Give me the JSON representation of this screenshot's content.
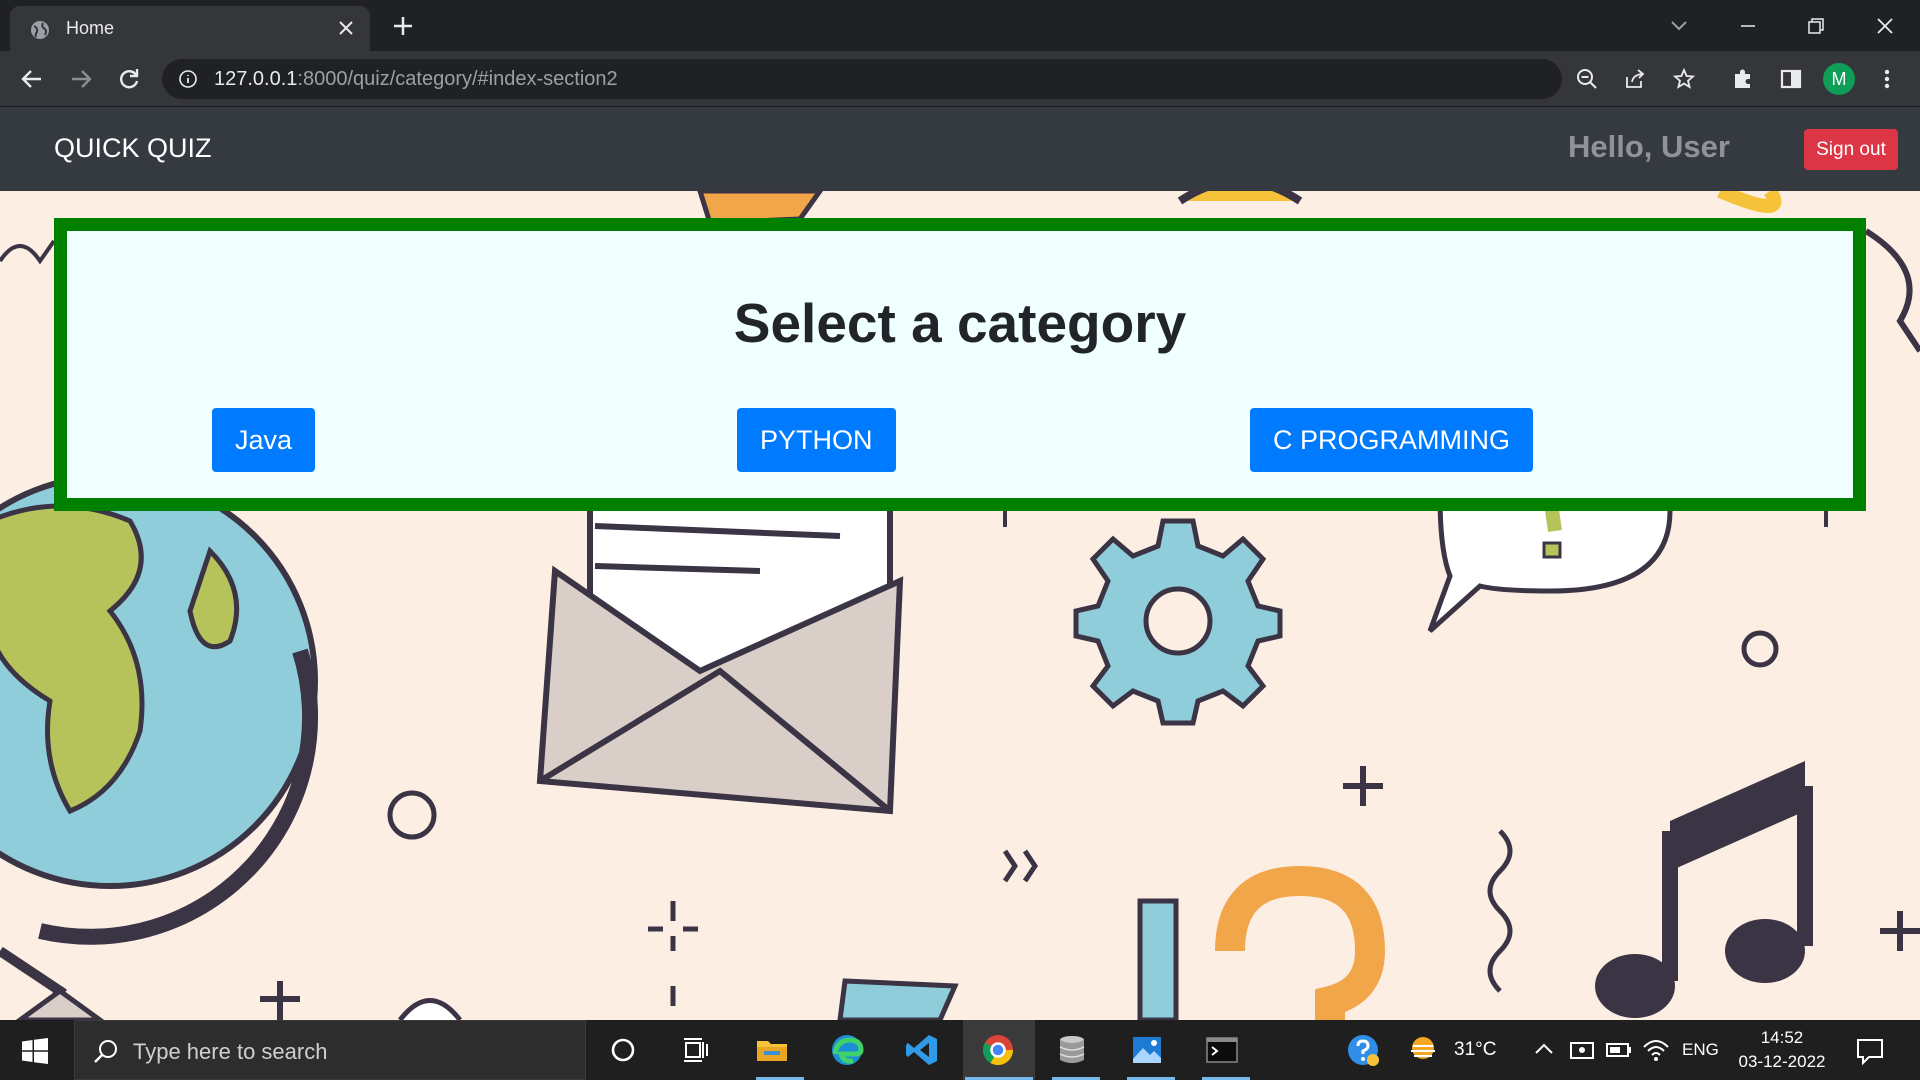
{
  "browser": {
    "tab_title": "Home",
    "url_host": "127.0.0.1",
    "url_rest": ":8000/quiz/category/#index-section2",
    "profile_initial": "M"
  },
  "navbar": {
    "brand": "QUICK QUIZ",
    "greeting": "Hello, User",
    "signout_label": "Sign out"
  },
  "main": {
    "heading": "Select a category",
    "categories": [
      "Java",
      "PYTHON",
      "C PROGRAMMING"
    ]
  },
  "taskbar": {
    "search_placeholder": "Type here to search",
    "temperature": "31°C",
    "language": "ENG",
    "time": "14:52",
    "date": "03-12-2022"
  },
  "colors": {
    "card_border": "#008000",
    "card_bg": "#f0ffff",
    "primary_button": "#007bff",
    "signout_button": "#dc3545",
    "navbar_bg": "#343a40"
  }
}
